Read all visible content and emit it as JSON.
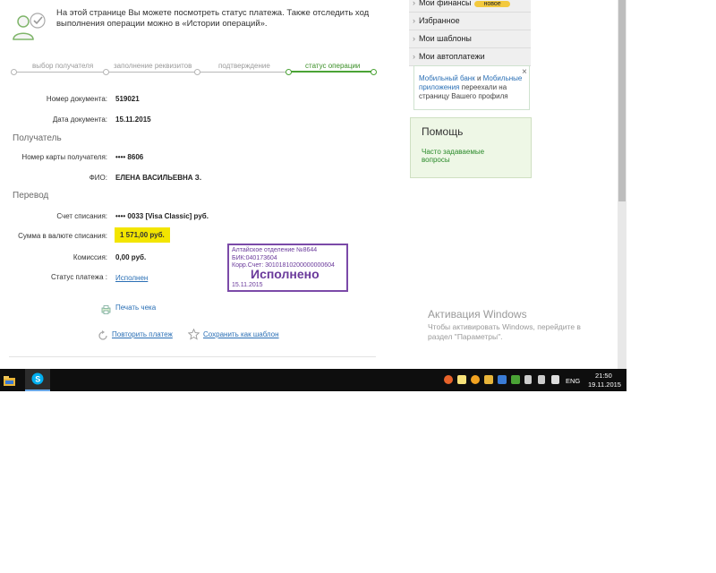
{
  "intro": {
    "text": "На этой странице Вы можете посмотреть статус платежа. Также отследить ход выполнения операции можно в «Истории операций»."
  },
  "steps": [
    {
      "label": "выбор получателя",
      "active": false
    },
    {
      "label": "заполнение реквизитов",
      "active": false
    },
    {
      "label": "подтверждение",
      "active": false
    },
    {
      "label": "статус операции",
      "active": true
    }
  ],
  "document": {
    "number_label": "Номер документа:",
    "number_value": "519021",
    "date_label": "Дата документа:",
    "date_value": "15.11.2015"
  },
  "recipient": {
    "section": "Получатель",
    "card_label": "Номер карты получателя:",
    "card_value": "•••• 8606",
    "name_label": "ФИО:",
    "name_value": "ЕЛЕНА ВАСИЛЬЕВНА З."
  },
  "transfer": {
    "section": "Перевод",
    "account_label": "Счет списания:",
    "account_value": "•••• 0033  [Visa Classic]  руб.",
    "amount_label": "Сумма в валюте списания:",
    "amount_value": "1 571,00  руб.",
    "commission_label": "Комиссия:",
    "commission_value": "0,00 руб.",
    "status_label": "Статус платежа :",
    "status_value": "Исполнен"
  },
  "stamp": {
    "line1": "Алтайское отделение №8644",
    "line2": "БИК:040173604",
    "line3": "Корр.Счет: 30101810200000000604",
    "status": "Исполнено",
    "date": "15.11.2015"
  },
  "actions": {
    "print": "Печать чека",
    "repeat": "Повторить платеж",
    "save_template": "Сохранить как шаблон"
  },
  "sidebar": {
    "menu": [
      {
        "label": "Мои финансы",
        "badge": "новое"
      },
      {
        "label": "Избранное"
      },
      {
        "label": "Мои шаблоны"
      },
      {
        "label": "Мои автоплатежи"
      }
    ],
    "notice": {
      "link1": "Мобильный банк",
      "and": " и ",
      "link2": "Мобильные приложения",
      "rest": " переехали на страницу Вашего профиля",
      "close": "×"
    },
    "help": {
      "title": "Помощь",
      "link": "Часто задаваемые вопросы"
    }
  },
  "activation": {
    "title": "Активация Windows",
    "body": "Чтобы активировать Windows, перейдите в раздел \"Параметры\"."
  },
  "taskbar": {
    "lang": "ENG",
    "time": "21:50",
    "date": "19.11.2015"
  },
  "colors": {
    "accent_green": "#4aa335",
    "highlight": "#f3e500",
    "stamp": "#6a3a9b",
    "link": "#2a6fb5"
  }
}
